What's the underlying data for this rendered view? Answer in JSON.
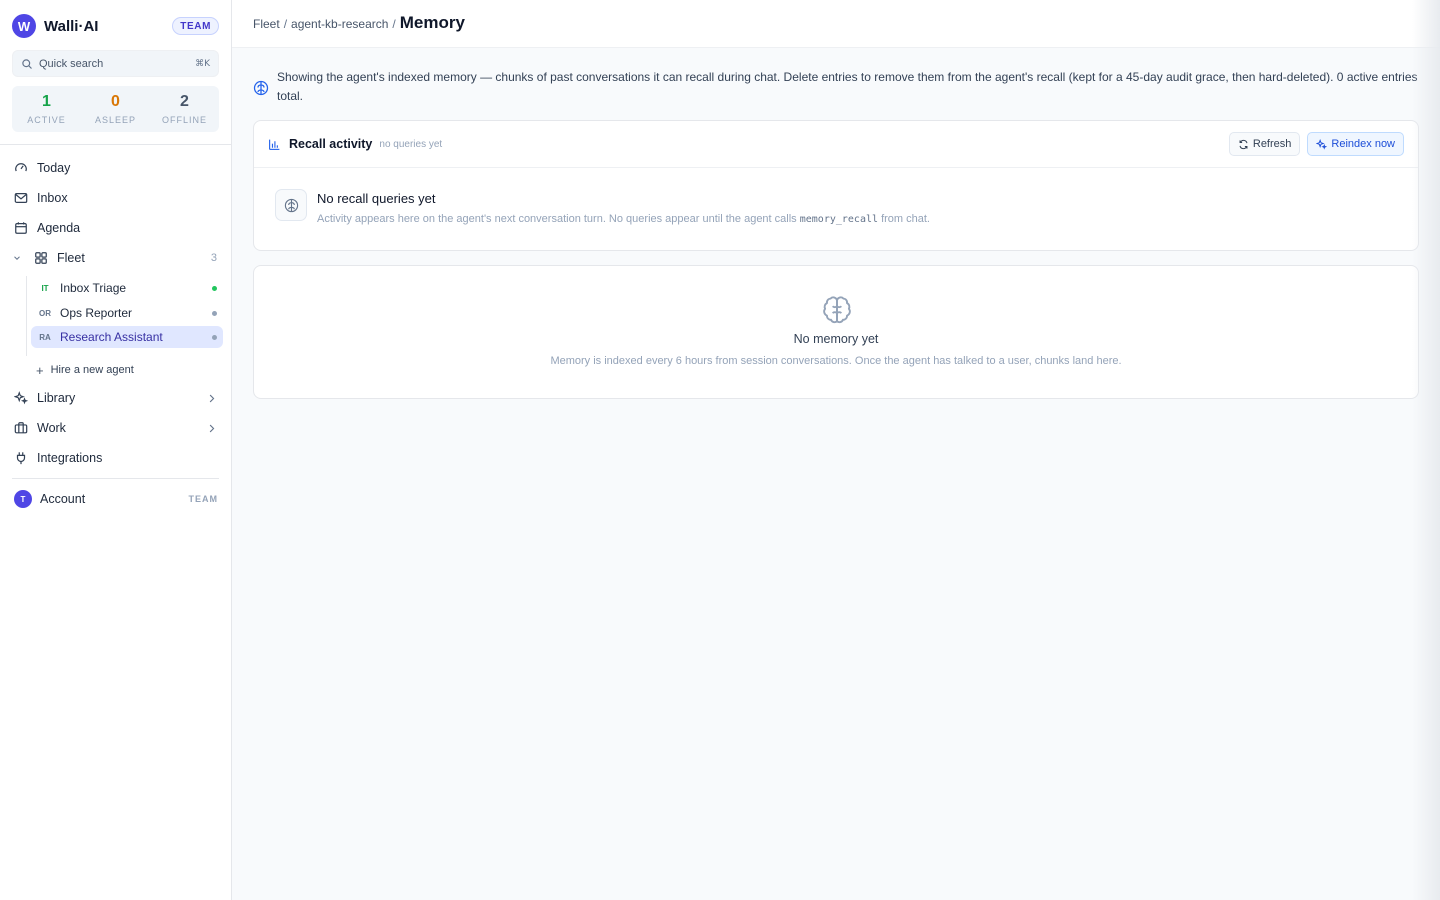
{
  "brand": {
    "logo_letter": "W",
    "name": "Walli·AI",
    "badge": "TEAM"
  },
  "search": {
    "placeholder": "Quick search",
    "shortcut": "⌘K"
  },
  "stats": [
    {
      "value": "1",
      "label": "ACTIVE",
      "color": "#16a34a"
    },
    {
      "value": "0",
      "label": "ASLEEP",
      "color": "#d97706"
    },
    {
      "value": "2",
      "label": "OFFLINE",
      "color": "#475569"
    }
  ],
  "nav": {
    "today": "Today",
    "inbox": "Inbox",
    "agenda": "Agenda",
    "fleet": {
      "label": "Fleet",
      "count": "3"
    },
    "agents": [
      {
        "initials": "IT",
        "name": "Inbox Triage",
        "status_color": "#22c55e"
      },
      {
        "initials": "OR",
        "name": "Ops Reporter",
        "status_color": "#94a3b8"
      },
      {
        "initials": "RA",
        "name": "Research Assistant",
        "status_color": "#94a3b8",
        "selected": true
      }
    ],
    "hire": "Hire a new agent",
    "library": "Library",
    "work": "Work",
    "integrations": "Integrations"
  },
  "account": {
    "avatar": "T",
    "label": "Account",
    "badge": "TEAM"
  },
  "breadcrumb": {
    "fleet": "Fleet",
    "agent": "agent-kb-research",
    "sep": "/",
    "current": "Memory"
  },
  "info": {
    "text": "Showing the agent's indexed memory — chunks of past conversations it can recall during chat. Delete entries to remove them from the agent's recall (kept for a 45-day audit grace, then hard-deleted). 0 active entries total."
  },
  "recall": {
    "title": "Recall activity",
    "subtitle": "no queries yet",
    "refresh": "Refresh",
    "reindex": "Reindex now",
    "empty_title": "No recall queries yet",
    "empty_desc_before": "Activity appears here on the agent's next conversation turn. No queries appear until the agent calls",
    "empty_desc_code": "memory_recall",
    "empty_desc_after": "from chat."
  },
  "memory": {
    "empty_title": "No memory yet",
    "empty_desc": "Memory is indexed every 6 hours from session conversations. Once the agent has talked to a user, chunks land here."
  }
}
